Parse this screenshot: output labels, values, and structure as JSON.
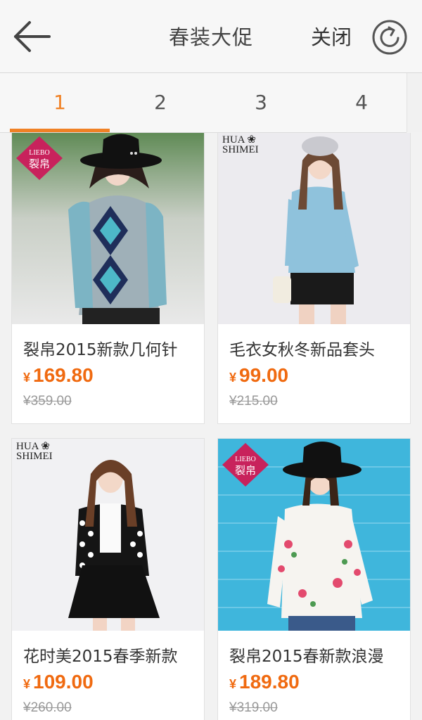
{
  "header": {
    "title": "春装大促",
    "close_label": "关闭"
  },
  "tabs": [
    {
      "label": "1",
      "active": true
    },
    {
      "label": "2",
      "active": false
    },
    {
      "label": "3",
      "active": false
    },
    {
      "label": "4",
      "active": false
    }
  ],
  "products": [
    {
      "name": "裂帛2015新款几何针",
      "currency": "¥",
      "price": "169.80",
      "original_price": "¥359.00",
      "brand_logo": "LIEBO 裂帛"
    },
    {
      "name": "毛衣女秋冬新品套头",
      "currency": "¥",
      "price": "99.00",
      "original_price": "¥215.00",
      "brand_logo": "HUA SHIMEI"
    },
    {
      "name": "花时美2015春季新款",
      "currency": "¥",
      "price": "109.00",
      "original_price": "¥260.00",
      "brand_logo": "HUA SHIMEI"
    },
    {
      "name": "裂帛2015春新款浪漫",
      "currency": "¥",
      "price": "189.80",
      "original_price": "¥319.00",
      "brand_logo": "LIEBO 裂帛"
    }
  ],
  "colors": {
    "accent": "#f08125",
    "price": "#f06a10"
  },
  "icons": {
    "back": "arrow-left-icon",
    "refresh": "refresh-icon"
  }
}
